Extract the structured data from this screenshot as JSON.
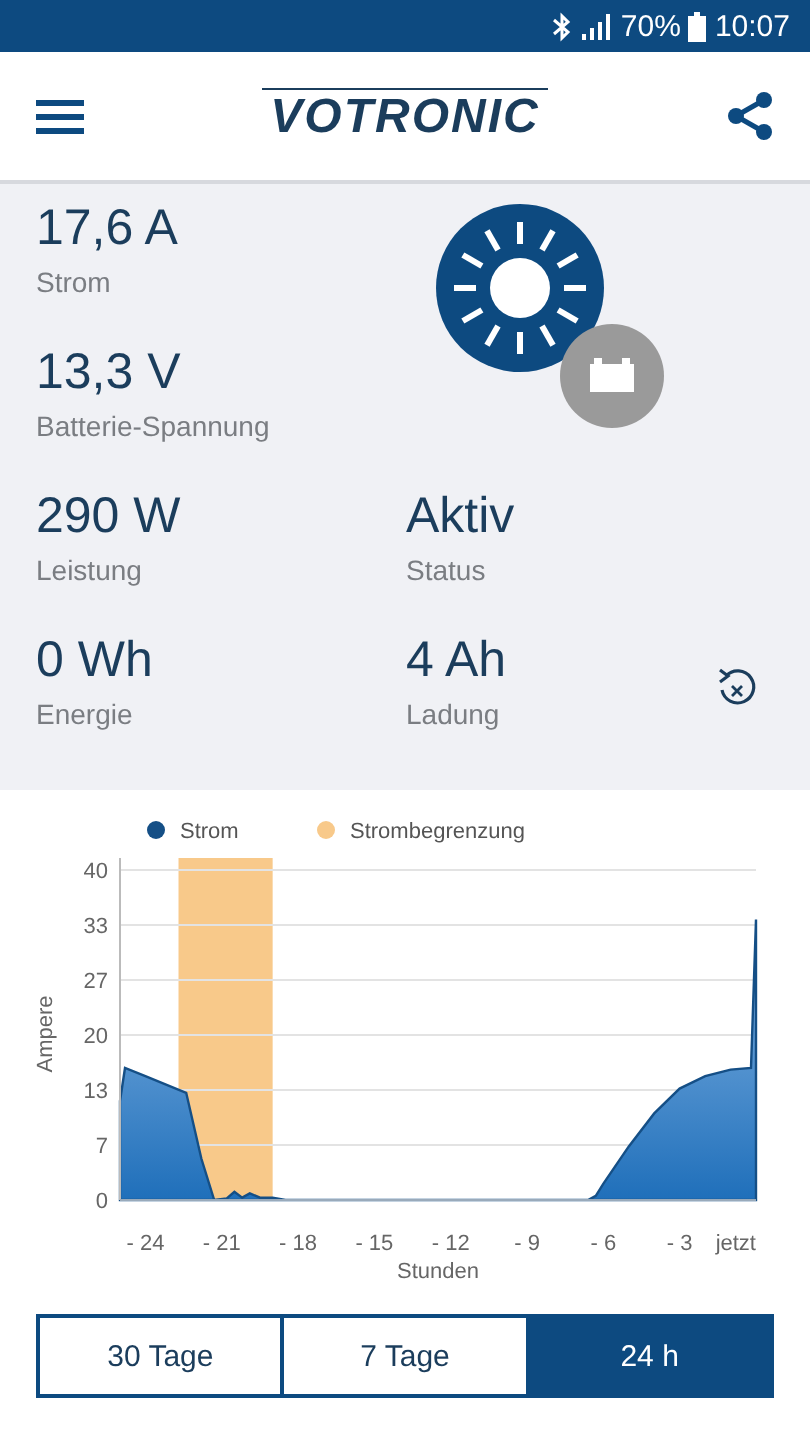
{
  "status_bar": {
    "battery_percent": "70%",
    "time": "10:07"
  },
  "header": {
    "logo": "VOTRONIC"
  },
  "metrics": [
    {
      "value": "17,6 A",
      "label": "Strom"
    },
    {
      "value": "13,3 V",
      "label": "Batterie-Spannung"
    },
    {
      "value": "290 W",
      "label": "Leistung"
    },
    {
      "value": "Aktiv",
      "label": "Status"
    },
    {
      "value": "0 Wh",
      "label": "Energie"
    },
    {
      "value": "4 Ah",
      "label": "Ladung"
    }
  ],
  "chart": {
    "chart_data": {
      "type": "area",
      "ylabel": "Ampere",
      "xlabel": "Stunden",
      "x": [
        -25,
        -24.8,
        -24,
        -22.4,
        -21.8,
        -21.3,
        -20.8,
        -20.5,
        -20.2,
        -19.9,
        -19.5,
        -19.0,
        -18.5,
        -6.6,
        -6.3,
        -6,
        -5,
        -4,
        -3,
        -2,
        -1,
        -0.2,
        0
      ],
      "series": [
        {
          "name": "Strom",
          "color": "#154f86",
          "values": [
            12,
            16,
            15,
            13,
            5,
            0,
            0.2,
            1,
            0.3,
            0.8,
            0.3,
            0.3,
            0,
            0,
            0.5,
            2,
            6.5,
            10.5,
            13.5,
            15,
            15.8,
            16,
            34
          ]
        }
      ],
      "xlim": [
        -25,
        0
      ],
      "ylim": [
        0,
        40
      ],
      "xticks": [
        {
          "value": -24,
          "label": "- 24"
        },
        {
          "value": -21,
          "label": "- 21"
        },
        {
          "value": -18,
          "label": "- 18"
        },
        {
          "value": -15,
          "label": "- 15"
        },
        {
          "value": -12,
          "label": "- 12"
        },
        {
          "value": -9,
          "label": "- 9"
        },
        {
          "value": -6,
          "label": "- 6"
        },
        {
          "value": -3,
          "label": "- 3"
        },
        {
          "value": 0,
          "label": "jetzt"
        }
      ],
      "yticks": [
        0,
        {
          "value": 6.67,
          "label": "7"
        },
        {
          "value": 13.33,
          "label": "13"
        },
        20,
        {
          "value": 26.67,
          "label": "27"
        },
        {
          "value": 33.33,
          "label": "33"
        },
        40
      ],
      "grid": true,
      "legend": "top",
      "bands": [
        {
          "label": "Strombegrenzung",
          "axis": "x",
          "from": -22.7,
          "to": -19,
          "color": "#f8c98a"
        }
      ]
    }
  },
  "range_buttons": [
    {
      "label": "30 Tage",
      "selected": false
    },
    {
      "label": "7 Tage",
      "selected": false
    },
    {
      "label": "24 h",
      "selected": true
    }
  ]
}
